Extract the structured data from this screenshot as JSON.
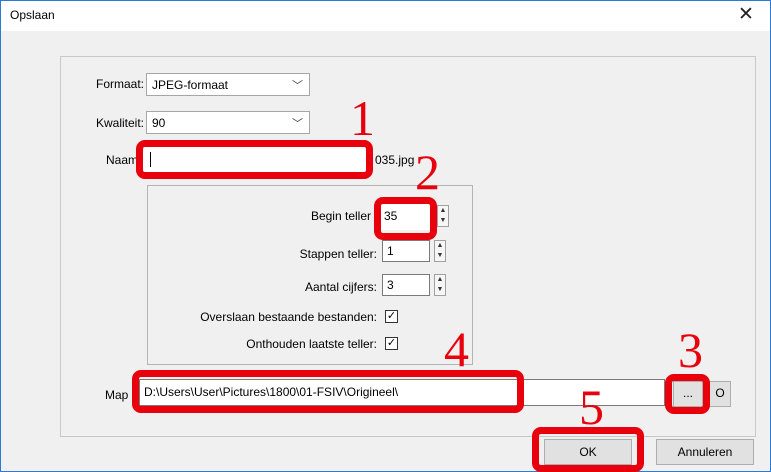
{
  "window": {
    "title": "Opslaan",
    "close_glyph": "✕"
  },
  "form": {
    "format_label": "Formaat:",
    "format_value": "JPEG-formaat",
    "quality_label": "Kwaliteit:",
    "quality_value": "90",
    "name_label": "Naam",
    "name_value": "",
    "name_suffix": "035.jpg",
    "begin_counter_label": "Begin teller",
    "begin_counter_value": "35",
    "step_counter_label": "Stappen teller:",
    "step_counter_value": "1",
    "digits_label": "Aantal cijfers:",
    "digits_value": "3",
    "skip_existing_label": "Overslaan bestaande bestanden:",
    "skip_existing_checked": true,
    "remember_counter_label": "Onthouden laatste teller:",
    "remember_counter_checked": true,
    "folder_label": "Map",
    "folder_value": "D:\\Users\\User\\Pictures\\1800\\01-FSIV\\Origineel\\",
    "browse_label": "...",
    "open_label": "O",
    "check_glyph": "✓",
    "chevron_glyph": "﹀"
  },
  "buttons": {
    "ok": "OK",
    "cancel": "Annuleren"
  },
  "annotations": {
    "color": "#e8000d",
    "markers": [
      "1",
      "2",
      "3",
      "4",
      "5"
    ]
  }
}
